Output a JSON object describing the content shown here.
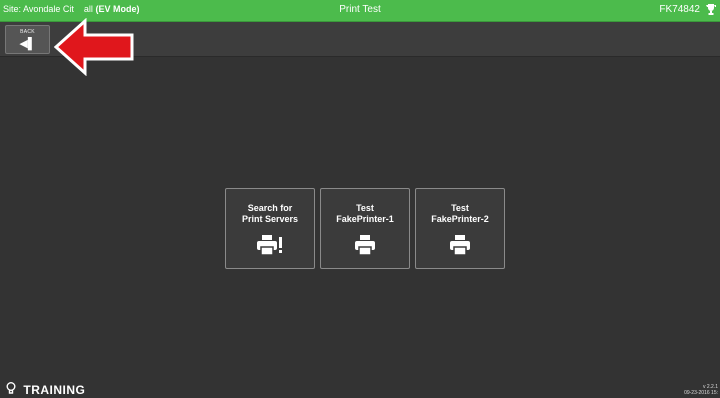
{
  "topbar": {
    "site": "Site: Avondale Cit",
    "site_suffix": "all",
    "mode": "(EV Mode)",
    "title": "Print Test",
    "device_id": "FK74842",
    "status_icon": "trophy-icon",
    "status_glyph": "⚓"
  },
  "toolbar": {
    "back_label": "BACK",
    "back_glyph": "◀▌"
  },
  "tiles": [
    {
      "line1": "Search for",
      "line2": "Print Servers",
      "icon": "printer-alert-icon"
    },
    {
      "line1": "Test",
      "line2": "FakePrinter-1",
      "icon": "printer-icon"
    },
    {
      "line1": "Test",
      "line2": "FakePrinter-2",
      "icon": "printer-icon"
    }
  ],
  "footer": {
    "training_label": "TRAINING",
    "bulb_glyph": "♀",
    "version": "v 2.2.1",
    "date": "09-23-2016 15:"
  },
  "colors": {
    "topbar": "#4CBB4C",
    "background": "#333333",
    "arrow": "#E0171C"
  }
}
